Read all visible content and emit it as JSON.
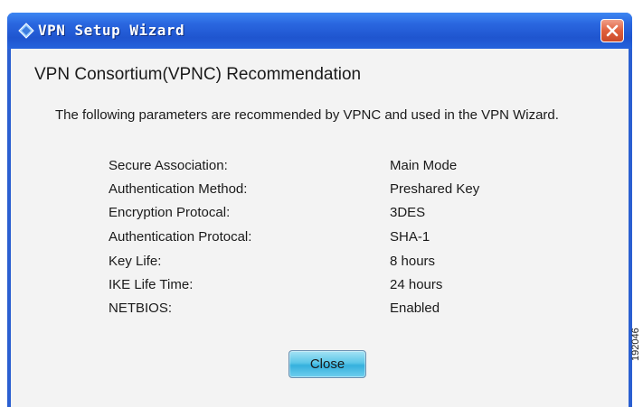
{
  "window": {
    "title": "VPN Setup Wizard"
  },
  "content": {
    "heading": "VPN Consortium(VPNC) Recommendation",
    "intro": "The following parameters are recommended by VPNC and used in the VPN Wizard.",
    "parameters": [
      {
        "label": "Secure Association:",
        "value": "Main Mode"
      },
      {
        "label": "Authentication Method:",
        "value": "Preshared Key"
      },
      {
        "label": "Encryption Protocal:",
        "value": "3DES"
      },
      {
        "label": "Authentication Protocal:",
        "value": "SHA-1"
      },
      {
        "label": "Key Life:",
        "value": "8 hours"
      },
      {
        "label": "IKE Life Time:",
        "value": "24 hours"
      },
      {
        "label": "NETBIOS:",
        "value": "Enabled"
      }
    ]
  },
  "buttons": {
    "close_label": "Close"
  },
  "figure_code": "192046"
}
